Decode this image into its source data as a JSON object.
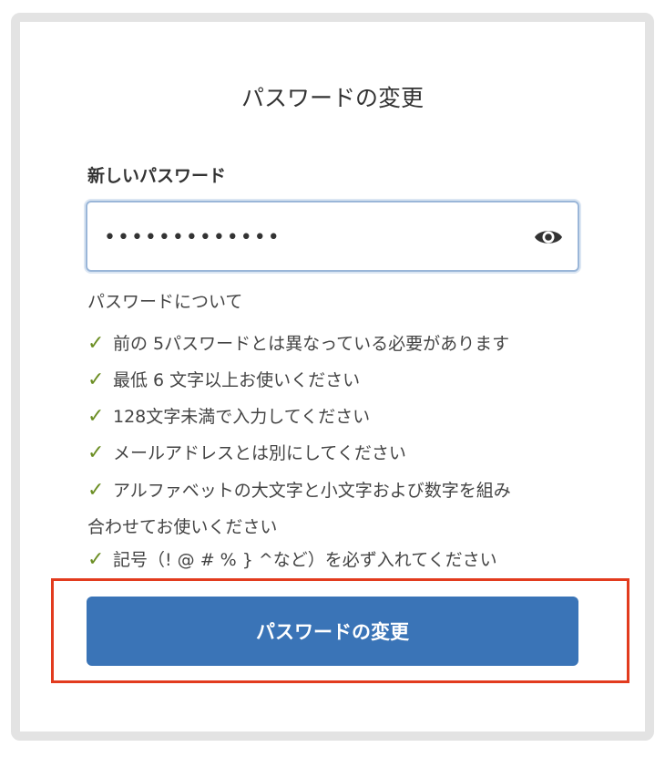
{
  "page": {
    "title": "パスワードの変更"
  },
  "password_field": {
    "label": "新しいパスワード",
    "value": "•••••••••••••",
    "toggle_icon": "eye-icon"
  },
  "requirements": {
    "heading": "パスワードについて",
    "check_icon": "check-icon",
    "check_glyph": "✓",
    "check_color": "#6b8e23",
    "items": [
      "前の 5パスワードとは異なっている必要があります",
      "最低 6 文字以上お使いください",
      "128文字未満で入力してください",
      "メールアドレスとは別にしてください",
      "アルファベットの大文字と小文字および数字を組み",
      "記号（! @ # % } ^など）を必ず入れてください"
    ],
    "item_5_continuation": "合わせてお使いください"
  },
  "submit": {
    "label": "パスワードの変更",
    "color": "#3a74b7",
    "highlight_color": "#e23b1e"
  }
}
